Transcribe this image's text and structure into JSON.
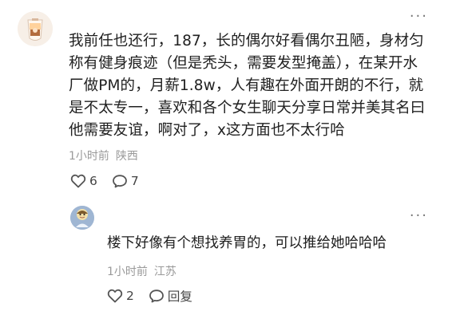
{
  "main_comment": {
    "text": "我前任也还行，187，长的偶尔好看偶尔丑陋，身材匀称有健身痕迹（但是秃头，需要发型掩盖），在某开水厂做PM的，月薪1.8w，人有趣在外面开朗的不行，就是不太专一，喜欢和各个女生聊天分享日常并美其名曰他需要友谊，啊对了，x这方面也不太行哈",
    "time": "1小时前",
    "location": "陕西",
    "like_count": "6",
    "comment_count": "7",
    "avatar_icon": "drink-avatar-icon"
  },
  "reply_comment": {
    "text": "楼下好像有个想找养胃的，可以推给她哈哈哈",
    "time": "1小时前",
    "location": "江苏",
    "like_count": "2",
    "reply_label": "回复",
    "avatar_icon": "cartoon-avatar-icon"
  },
  "menu": {
    "more_label": "···"
  }
}
